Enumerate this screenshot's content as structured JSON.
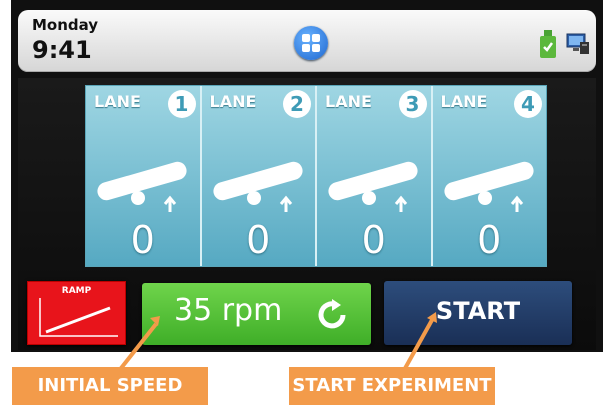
{
  "status": {
    "day": "Monday",
    "time": "9:41"
  },
  "icons": {
    "apps": "grid-icon",
    "usb": "usb-check-icon",
    "computer": "computer-network-icon",
    "refresh": "refresh-icon"
  },
  "lanes": [
    {
      "label": "LANE",
      "number": "1",
      "count": "0"
    },
    {
      "label": "LANE",
      "number": "2",
      "count": "0"
    },
    {
      "label": "LANE",
      "number": "3",
      "count": "0"
    },
    {
      "label": "LANE",
      "number": "4",
      "count": "0"
    }
  ],
  "controls": {
    "ramp_label": "RAMP",
    "speed": "35 rpm",
    "start_label": "START"
  },
  "annotations": {
    "initial_speed": "INITIAL SPEED",
    "start_experiment": "START EXPERIMENT"
  },
  "colors": {
    "lane_bg": "#6fb9cc",
    "speed_button": "#4fc236",
    "start_button": "#233e69",
    "ramp_button": "#e8141b",
    "callout": "#f39b4a"
  }
}
